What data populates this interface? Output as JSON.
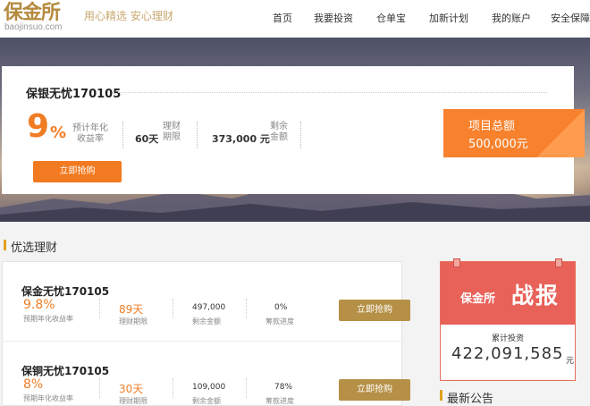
{
  "header": {
    "logo_main": "保金所",
    "logo_sub": "baojinsuo.com",
    "slogan": "用心精选 安心理财",
    "nav": [
      "首页",
      "我要投资",
      "仓单宝",
      "加新计划",
      "我的账户",
      "安全保障"
    ]
  },
  "hero": {
    "product_name": "保银无忧170105",
    "rate_value": "9",
    "rate_unit": "%",
    "rate_label": "预计年化收益率",
    "term_value": "60天",
    "term_label": "理财期限",
    "remain_value": "373,000 元",
    "remain_label": "剩余金额",
    "buy_label": "立即抢购",
    "total_label": "项目总额",
    "total_value": "500,000元"
  },
  "section": {
    "title": "优选理财"
  },
  "products": [
    {
      "name": "保金无忧170105",
      "rate": "9.8%",
      "rate_label": "预期年化收益率",
      "term": "89天",
      "term_label": "理财期限",
      "remain": "497,000",
      "remain_label": "剩余金额",
      "progress": "0%",
      "progress_label": "筹款进度",
      "buy_label": "立即抢购"
    },
    {
      "name": "保铜无忧170105",
      "rate": "8%",
      "rate_label": "预期年化收益率",
      "term": "30天",
      "term_label": "理财期限",
      "remain": "109,000",
      "remain_label": "剩余金额",
      "progress": "78%",
      "progress_label": "筹款进度",
      "buy_label": "立即抢购"
    }
  ],
  "report": {
    "brand": "保金所",
    "title": "战报",
    "label": "累计投资",
    "value": "422,091,585",
    "unit": "元"
  },
  "news": {
    "title": "最新公告"
  },
  "colors": {
    "accent_orange": "#f27a20",
    "gold": "#b59046",
    "report_red": "#e8625a"
  }
}
